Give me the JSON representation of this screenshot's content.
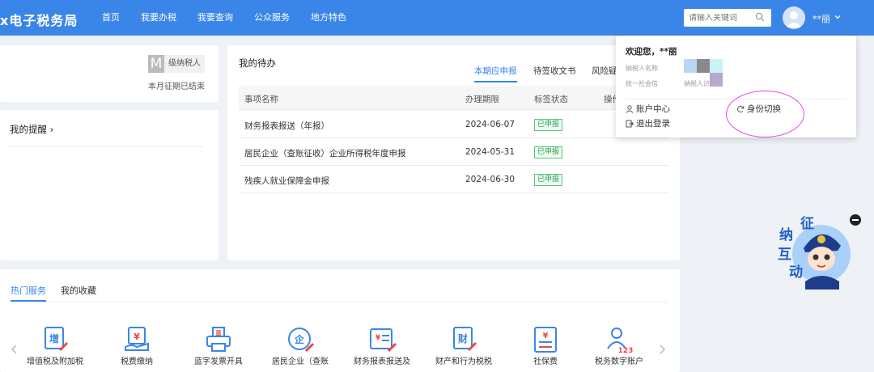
{
  "header": {
    "brand": "x电子税务局",
    "nav": [
      "首页",
      "我要办税",
      "我要查询",
      "公众服务",
      "地方特色"
    ],
    "search_placeholder": "请输入关键词",
    "user_name": "**丽"
  },
  "profile_card": {
    "badge_letter": "M",
    "grade": "级纳税人",
    "period_status": "本月征期已结束"
  },
  "reminders": {
    "title": "我的提醒 ›"
  },
  "todo": {
    "title": "我的待办",
    "tabs": [
      "本期应申报",
      "待签收文书",
      "风险疑"
    ],
    "columns": [
      "事项名称",
      "办理期限",
      "标签状态",
      "操作"
    ],
    "rows": [
      {
        "name": "财务报表报送（年报）",
        "deadline": "2024-06-07",
        "status": "已申报"
      },
      {
        "name": "居民企业（查账征收）企业所得税年度申报",
        "deadline": "2024-05-31",
        "status": "已申报"
      },
      {
        "name": "残疾人就业保障金申报",
        "deadline": "2024-06-30",
        "status": "已申报"
      }
    ]
  },
  "services": {
    "tabs": [
      "热门服务",
      "我的收藏"
    ],
    "items": [
      {
        "label": "增值税及附加税",
        "icon": "vat-icon"
      },
      {
        "label": "税费缴纳",
        "icon": "tax-payment-icon"
      },
      {
        "label": "蓝字发票开具",
        "icon": "invoice-printer-icon"
      },
      {
        "label": "居民企业（查账",
        "icon": "enterprise-icon"
      },
      {
        "label": "财务报表报送及",
        "icon": "financial-report-icon"
      },
      {
        "label": "财产和行为税税",
        "icon": "property-tax-icon"
      },
      {
        "label": "社保费",
        "icon": "social-insurance-icon"
      },
      {
        "label": "税务数字账户",
        "icon": "digital-account-icon"
      }
    ]
  },
  "dropdown": {
    "welcome": "欢迎您，**丽",
    "taxpayer_name_label": "纳税人名称",
    "credit_code_label": "统一社会信",
    "taxpayer_id_label": "纳税人识",
    "account_center": "账户中心",
    "logout": "退出登录",
    "switch_identity": "身份切换"
  },
  "mascot": {
    "chars": [
      "征",
      "纳",
      "互",
      "动"
    ]
  },
  "colors": {
    "primary": "#3a86e8",
    "success": "#2aa352",
    "highlight": "#e048e8"
  }
}
